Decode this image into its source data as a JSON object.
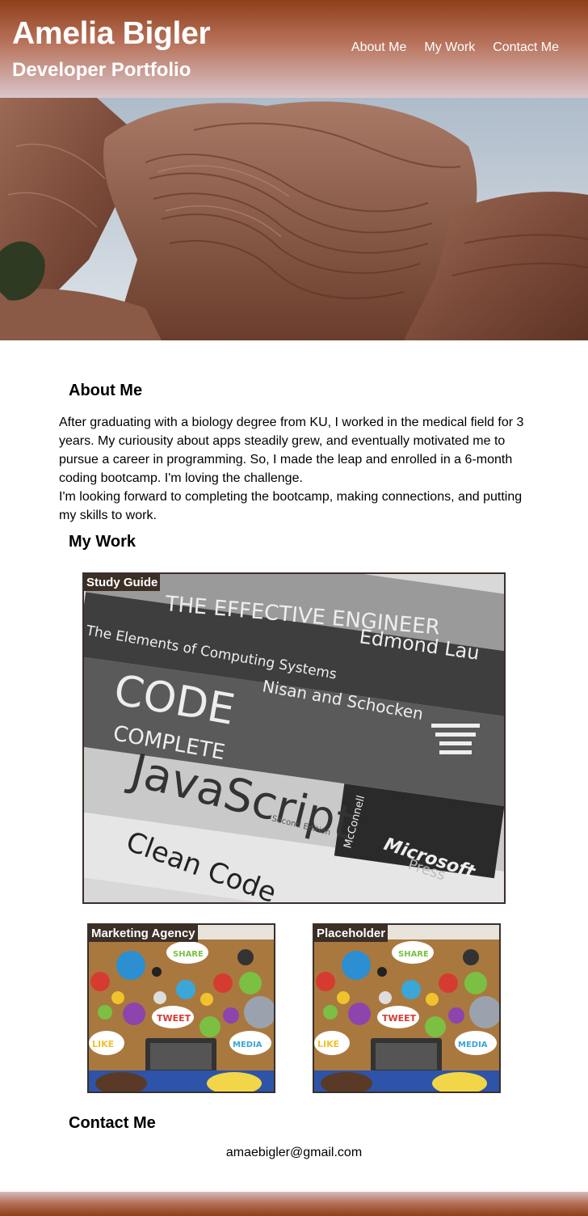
{
  "header": {
    "name": "Amelia Bigler",
    "subtitle": "Developer Portfolio",
    "nav": [
      "About Me",
      "My Work",
      "Contact Me"
    ]
  },
  "about": {
    "heading": "About Me",
    "paragraph1": "After graduating with a biology degree from KU, I worked in the medical field for 3 years. My curiousity about apps steadily grew, and eventually motivated me to pursue a career in programming. So, I made the leap and enrolled in a 6-month coding bootcamp. I'm loving the challenge.",
    "paragraph2": "I'm looking forward to completing the bootcamp, making connections, and putting my skills to work."
  },
  "work": {
    "heading": "My Work",
    "projects": [
      {
        "label": "Study Guide"
      },
      {
        "label": "Marketing Agency"
      },
      {
        "label": "Placeholder"
      }
    ],
    "book_spines": [
      "THE EFFECTIVE ENGINEER",
      "Edmond Lau",
      "The Elements of Computing Systems",
      "Nisan and Schocken",
      "CODE",
      "COMPLETE",
      "JavaScript",
      "Second Edition",
      "McConnell",
      "Microsoft",
      "Press",
      "Clean Code"
    ],
    "social_words": [
      "TWEET",
      "LIKE",
      "MEDIA",
      "SHARE"
    ]
  },
  "contact": {
    "heading": "Contact Me",
    "email": "amaebigler@gmail.com"
  },
  "colors": {
    "header_top": "#8e3e1a",
    "header_bottom": "#d9c6cb",
    "label_bg": "#3b2f26"
  }
}
